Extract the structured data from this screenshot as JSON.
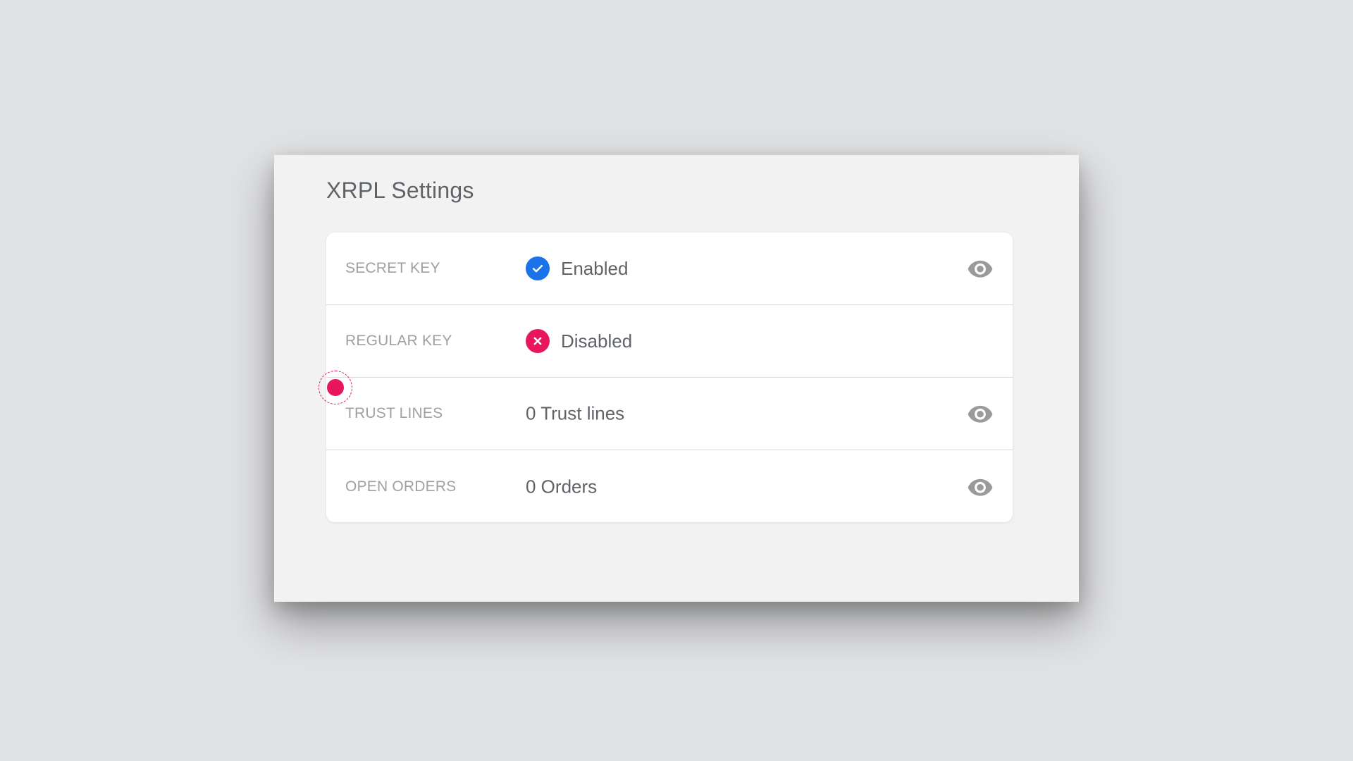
{
  "panel": {
    "title": "XRPL Settings"
  },
  "rows": [
    {
      "label": "SECRET KEY",
      "value": "Enabled",
      "status": "enabled",
      "status_icon": "check-circle-icon",
      "has_view": true
    },
    {
      "label": "REGULAR KEY",
      "value": "Disabled",
      "status": "disabled",
      "status_icon": "x-circle-icon",
      "has_view": false
    },
    {
      "label": "TRUST LINES",
      "value": "0 Trust lines",
      "has_view": true
    },
    {
      "label": "OPEN ORDERS",
      "value": "0 Orders",
      "has_view": true
    }
  ],
  "colors": {
    "enabled": "#1a73e8",
    "disabled": "#e8175d",
    "label": "#a0a0a0",
    "value": "#5f6368",
    "cursor": "#e8175d"
  },
  "icons": {
    "view": "eye-icon"
  }
}
